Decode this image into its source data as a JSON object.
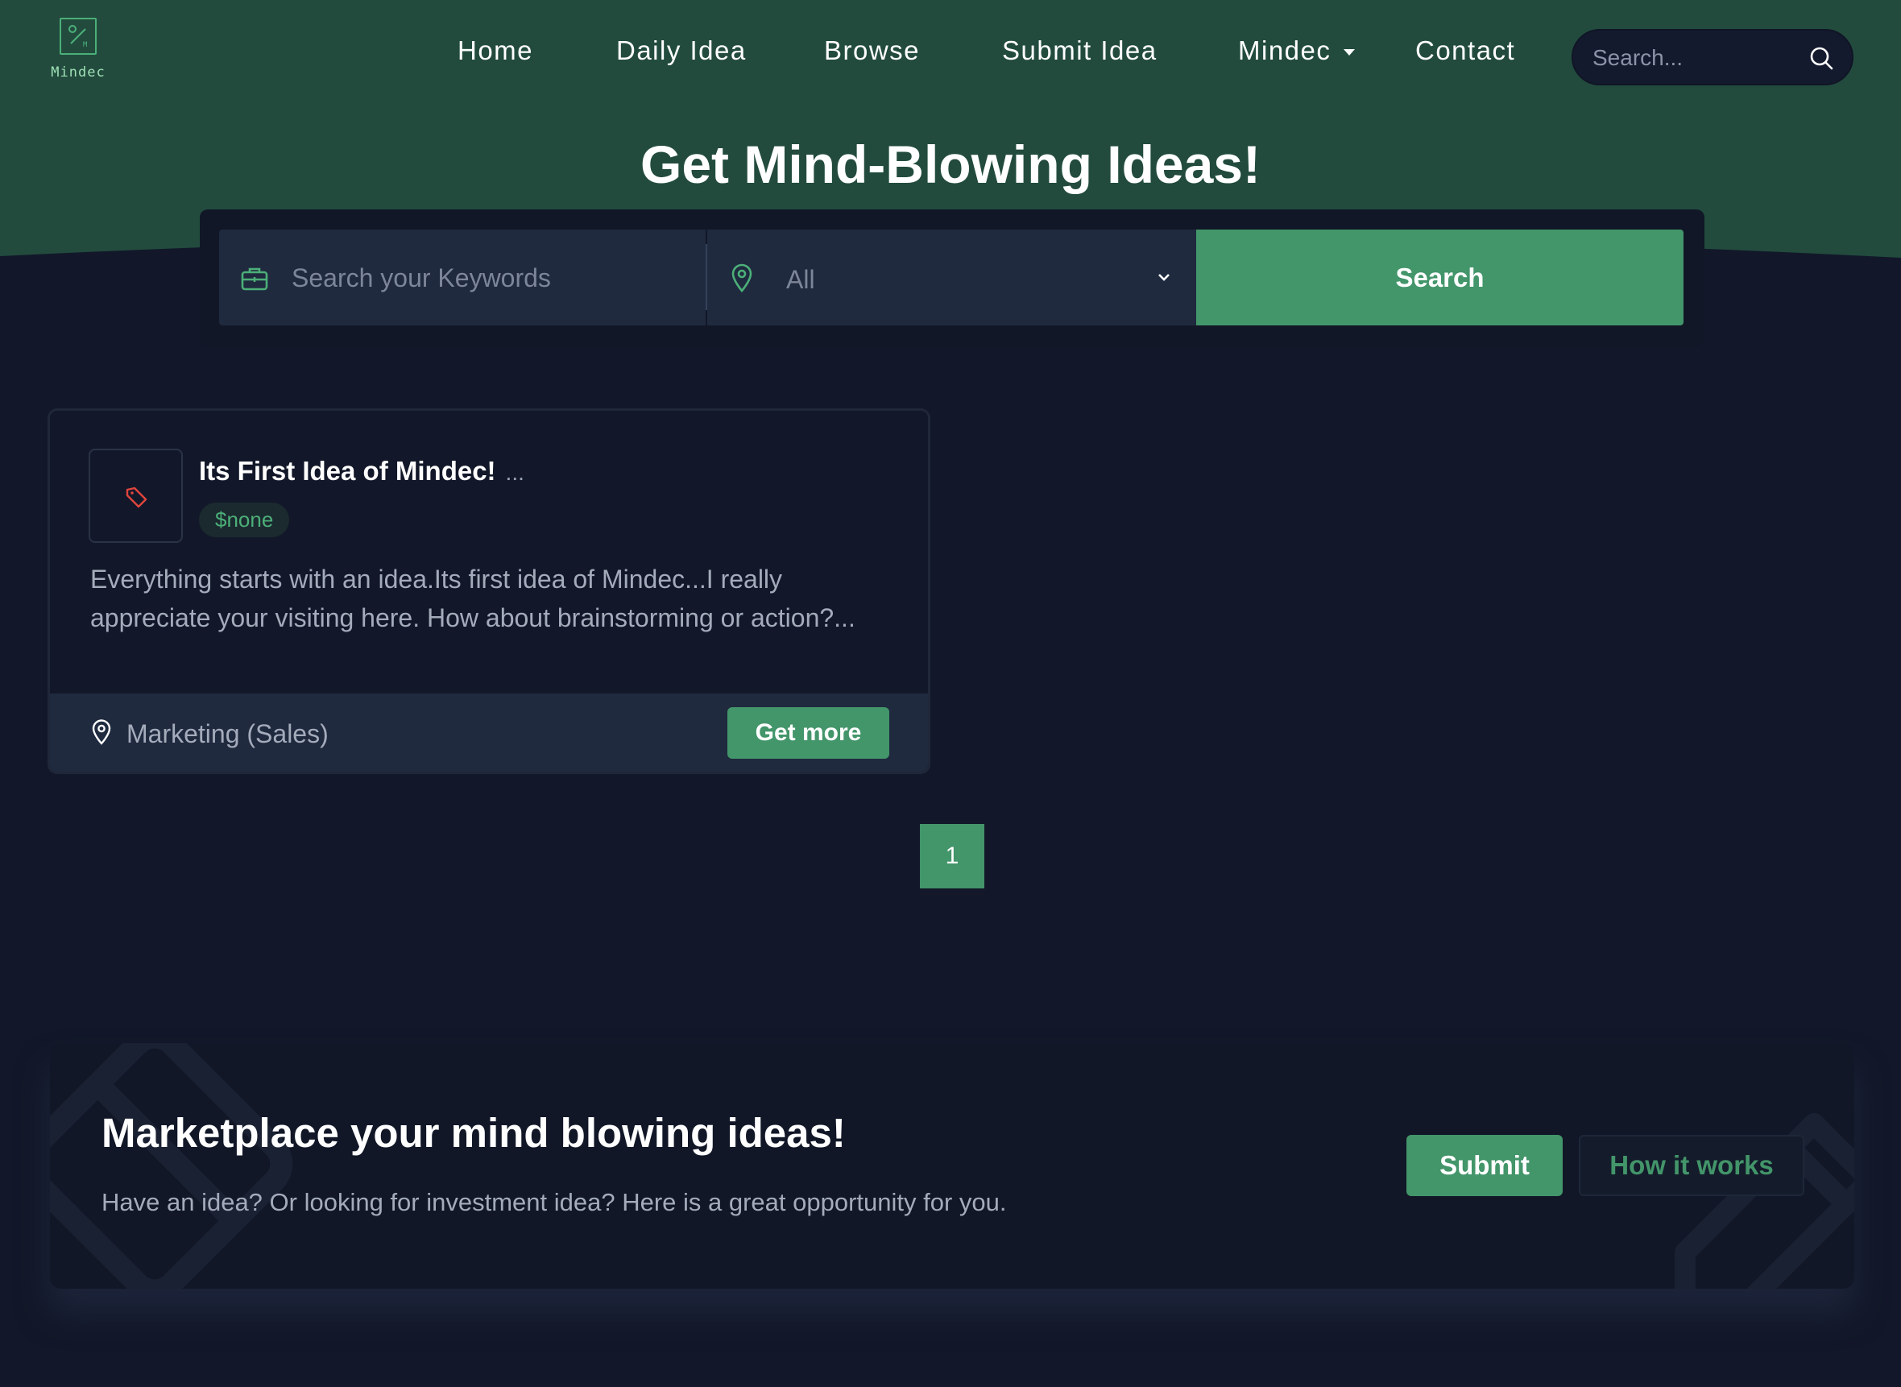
{
  "colors": {
    "header_green": "#224b3e",
    "accent_green": "#43956a",
    "page_bg": "#121829",
    "panel_bg": "#1f2a3f"
  },
  "header": {
    "logo_text": "Mindec",
    "nav": [
      {
        "label": "Home"
      },
      {
        "label": "Daily Idea"
      },
      {
        "label": "Browse"
      },
      {
        "label": "Submit Idea"
      },
      {
        "label": "Mindec",
        "has_dropdown": true
      },
      {
        "label": "Contact"
      }
    ],
    "search_placeholder": "Search...",
    "search_icon": "search-icon"
  },
  "hero": {
    "title": "Get Mind-Blowing Ideas!",
    "keyword_placeholder": "Search your Keywords",
    "keyword_icon": "briefcase-icon",
    "location_icon": "location-pin-icon",
    "location_value": "All",
    "search_button": "Search"
  },
  "ideas": [
    {
      "title": "Its First Idea of Mindec!",
      "title_more": "...",
      "icon": "tag-icon",
      "price": "$none",
      "description": "Everything starts with an idea.Its first idea of Mindec...I really appreciate your visiting here. How about brainstorming or action?...",
      "category": "Marketing (Sales)",
      "button": "Get more"
    }
  ],
  "pagination": {
    "current": "1"
  },
  "cta": {
    "title": "Marketplace your mind blowing ideas!",
    "subtitle": "Have an idea? Or looking for investment idea? Here is a great opportunity for you.",
    "submit_button": "Submit",
    "how_button": "How it works"
  }
}
